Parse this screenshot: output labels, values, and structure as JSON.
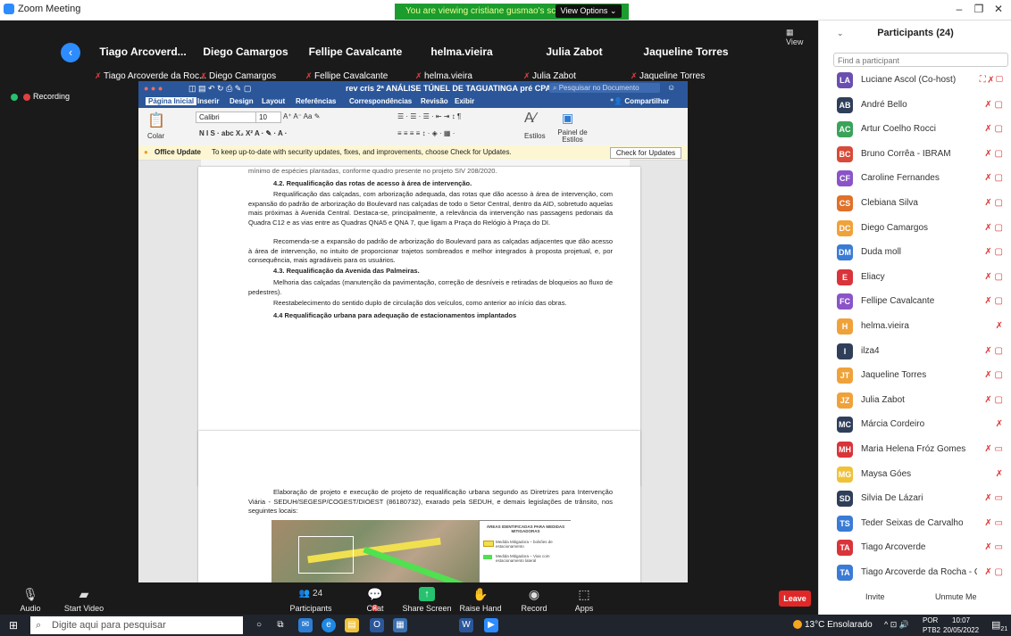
{
  "window": {
    "title": "Zoom Meeting"
  },
  "share_banner": {
    "message": "You are viewing cristiane gusmao's screen",
    "view_options": "View Options ⌄"
  },
  "view_button": "View",
  "thumbnails": [
    {
      "name": "Tiago Arcoverd...",
      "sub": "Tiago Arcoverde da Roc..."
    },
    {
      "name": "Diego Camargos",
      "sub": "Diego Camargos"
    },
    {
      "name": "Fellipe Cavalcante",
      "sub": "Fellipe Cavalcante"
    },
    {
      "name": "helma.vieira",
      "sub": "helma.vieira"
    },
    {
      "name": "Julia Zabot",
      "sub": "Julia Zabot"
    },
    {
      "name": "Jaqueline Torres",
      "sub": "Jaqueline Torres"
    }
  ],
  "recording": "Recording",
  "word": {
    "doc_title": "rev cris 2ª ANÁLISE TÚNEL DE TAGUATINGA pré CPA (1)",
    "search_placeholder": "Pesquisar no Documento",
    "tabs": [
      "Página Inicial",
      "Inserir",
      "Design",
      "Layout",
      "Referências",
      "Correspondências",
      "Revisão",
      "Exibir"
    ],
    "share": "Compartilhar",
    "font": "Calibri",
    "font_size": "10",
    "paste": "Colar",
    "styles": "Estilos",
    "styles_pane": "Painel de Estilos",
    "update_bold": "Office Update",
    "update_msg": "To keep up-to-date with security updates, fixes, and improvements, choose Check for Updates.",
    "update_btn": "Check for Updates",
    "page1": {
      "top_line": "mínimo de espécies plantadas, conforme quadro presente no projeto SIV 208/2020.",
      "h42": "4.2. Requalificação das rotas de acesso à área de intervenção.",
      "p1": "Requalificação das calçadas, com arborização adequada, das rotas que dão acesso à área de intervenção, com expansão do padrão de arborização do Boulevard nas calçadas de todo o Setor Central, dentro da AID, sobretudo aquelas mais próximas à Avenida Central. Destaca-se, principalmente, a relevância da intervenção nas passagens pedonais da Quadra C12 e as vias entre as Quadras QNA5 e QNA 7, que ligam a Praça do Relógio à Praça do DI.",
      "p2": "Recomenda-se a expansão do padrão de arborização do Boulevard para as calçadas adjacentes que dão acesso à área de intervenção, no intuito de proporcionar trajetos sombreados e melhor integrados à proposta projetual, e, por consequência, mais agradáveis para os usuários.",
      "h43": "4.3. Requalificação da Avenida das Palmeiras.",
      "p3": "Melhoria das calçadas (manutenção da pavimentação, correção de desníveis e retiradas de bloqueios ao fluxo de pedestres).",
      "p4": "Reestabelecimento do sentido duplo de circulação dos veículos, como anterior ao início das obras.",
      "h44": "4.4 Requalificação urbana para adequação de estacionamentos implantados"
    },
    "page2": {
      "p1": "Elaboração de projeto e execução de projeto de requalificação urbana segundo as Diretrizes para Intervenção Viária - SEDUH/SEGESP/COGEST/DIOEST (86180732), exarado pela SEDUH, e demais legislações de trânsito, nos seguintes locais:",
      "legend_title": "ÁREAS IDENTIFICADAS PARA MEDIDAS MITIGADORAS",
      "legend_1": "Medida Mitigadora – bolsões de estacionamento",
      "legend_2": "Medida Mitigadora – Vias com estacionamento lateral"
    }
  },
  "toolbar": {
    "audio": "Audio",
    "start_video": "Start Video",
    "participants": "Participants",
    "participants_count": "24",
    "chat": "Chat",
    "chat_badge": "2",
    "share_screen": "Share Screen",
    "raise_hand": "Raise Hand",
    "record": "Record",
    "apps": "Apps",
    "leave": "Leave"
  },
  "panel": {
    "title": "Participants (24)",
    "find_placeholder": "Find a participant",
    "participants": [
      {
        "initials": "LA",
        "name": "Luciane Ascol (Co-host)",
        "color": "#6a4fb0",
        "icons": "⛶ ✗ ▢"
      },
      {
        "initials": "AB",
        "name": "André Bello",
        "color": "#2f3f5a",
        "icons": "✗ ▢"
      },
      {
        "initials": "AC",
        "name": "Artur Coelho Rocci",
        "color": "#3aa35a",
        "icons": "✗ ▢"
      },
      {
        "initials": "BC",
        "name": "Bruno Corrêa - IBRAM",
        "color": "#d84a3a",
        "icons": "✗ ▢"
      },
      {
        "initials": "CF",
        "name": "Caroline Fernandes",
        "color": "#8a54c8",
        "icons": "✗ ▢"
      },
      {
        "initials": "CS",
        "name": "Clebiana Silva",
        "color": "#e0702a",
        "icons": "✗ ▢"
      },
      {
        "initials": "DC",
        "name": "Diego Camargos",
        "color": "#f0a23a",
        "icons": "✗ ▢"
      },
      {
        "initials": "DM",
        "name": "Duda moll",
        "color": "#3a7bd5",
        "icons": "✗ ▢"
      },
      {
        "initials": "E",
        "name": "Eliacy",
        "color": "#d8343a",
        "icons": "✗ ▢"
      },
      {
        "initials": "FC",
        "name": "Fellipe Cavalcante",
        "color": "#8a54c8",
        "icons": "✗ ▢"
      },
      {
        "initials": "H",
        "name": "helma.vieira",
        "color": "#f0a23a",
        "icons": "✗"
      },
      {
        "initials": "I",
        "name": "ilza4",
        "color": "#2f3f5a",
        "icons": "✗ ▢"
      },
      {
        "initials": "JT",
        "name": "Jaqueline Torres",
        "color": "#f0a23a",
        "icons": "✗ ▢"
      },
      {
        "initials": "JZ",
        "name": "Julia Zabot",
        "color": "#f0a23a",
        "icons": "✗ ▢"
      },
      {
        "initials": "MC",
        "name": "Márcia Cordeiro",
        "color": "#2f3f5a",
        "icons": "✗"
      },
      {
        "initials": "MH",
        "name": "Maria Helena Fróz Gomes",
        "color": "#d8343a",
        "icons": "✗ ▭"
      },
      {
        "initials": "MG",
        "name": "Maysa Góes",
        "color": "#f0c23a",
        "icons": "✗"
      },
      {
        "initials": "SD",
        "name": "Silvia De Lázari",
        "color": "#2f3f5a",
        "icons": "✗ ▭"
      },
      {
        "initials": "TS",
        "name": "Teder Seixas de Carvalho",
        "color": "#3a7bd5",
        "icons": "✗ ▭"
      },
      {
        "initials": "TA",
        "name": "Tiago Arcoverde",
        "color": "#d8343a",
        "icons": "✗ ▭"
      },
      {
        "initials": "TA",
        "name": "Tiago Arcoverde da Rocha - C...",
        "color": "#3a7bd5",
        "icons": "✗ ▢"
      }
    ],
    "invite": "Invite",
    "unmute_me": "Unmute Me"
  },
  "taskbar": {
    "search_placeholder": "Digite aqui para pesquisar",
    "weather": "13°C  Ensolarado",
    "lang_1": "POR",
    "lang_2": "PTB2",
    "time": "10:07",
    "date": "20/05/2022",
    "notif_count": "21"
  }
}
